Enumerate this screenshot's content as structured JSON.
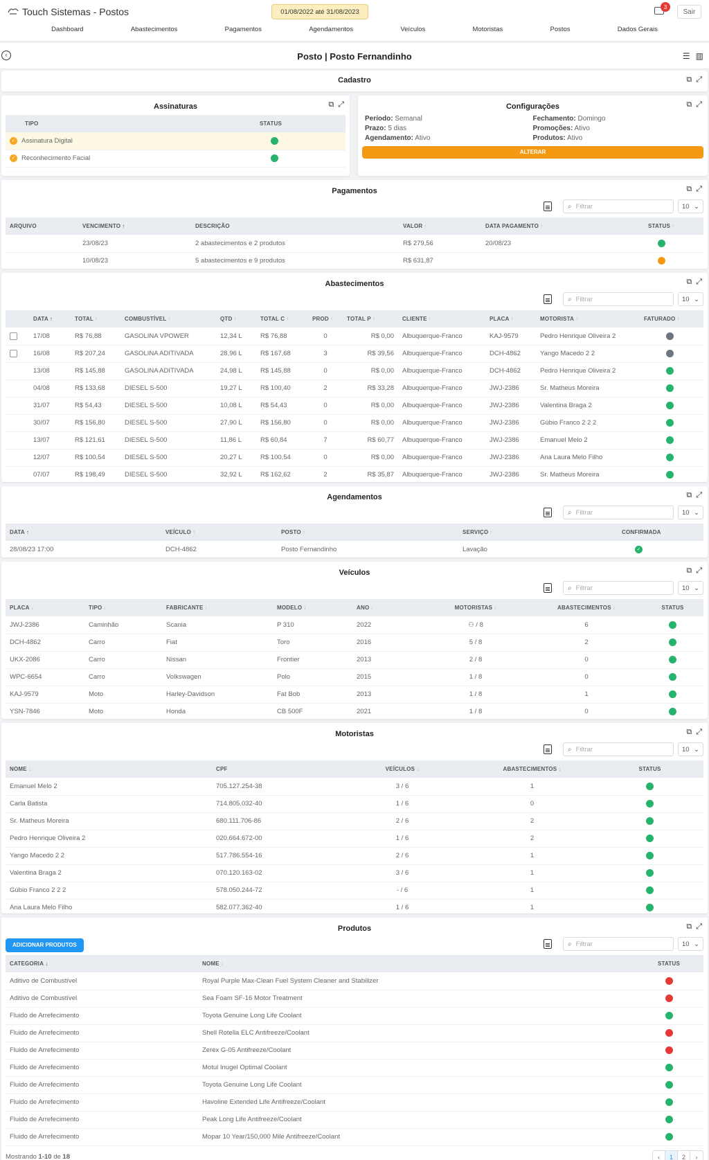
{
  "app": {
    "title": "Touch Sistemas - Postos",
    "date_range": "01/08/2022 até 31/08/2023",
    "notif_count": "3",
    "logout": "Sair"
  },
  "nav": [
    "Dashboard",
    "Abastecimentos",
    "Pagamentos",
    "Agendamentos",
    "Veículos",
    "Motoristas",
    "Postos",
    "Dados Gerais"
  ],
  "page": {
    "title": "Posto | Posto Fernandinho"
  },
  "cadastro": {
    "title": "Cadastro"
  },
  "filter_placeholder": "Filtrar",
  "page_size": "10",
  "colors": {
    "green": "#26b36b",
    "gray": "#6c757d",
    "orange": "#f39a12",
    "red": "#e53935",
    "blue": "#2196f3"
  },
  "assinaturas": {
    "title": "Assinaturas",
    "headers": [
      "TIPO",
      "STATUS"
    ],
    "rows": [
      {
        "tipo": "Assinatura Digital",
        "status": "green"
      },
      {
        "tipo": "Reconhecimento Facial",
        "status": "green"
      }
    ]
  },
  "configuracoes": {
    "title": "Configurações",
    "items": [
      {
        "label": "Período:",
        "value": "Semanal"
      },
      {
        "label": "Fechamento:",
        "value": "Domingo"
      },
      {
        "label": "Prazo:",
        "value": "5 dias"
      },
      {
        "label": "Promoções:",
        "value": "Ativo"
      },
      {
        "label": "Agendamento:",
        "value": "Ativo"
      },
      {
        "label": "Produtos:",
        "value": "Ativo"
      }
    ],
    "button": "ALTERAR"
  },
  "pagamentos": {
    "title": "Pagamentos",
    "headers": [
      "ARQUIVO",
      "VENCIMENTO",
      "DESCRIÇÃO",
      "VALOR",
      "DATA PAGAMENTO",
      "STATUS"
    ],
    "rows": [
      {
        "arquivo": "",
        "vencimento": "23/08/23",
        "descricao": "2 abastecimentos e 2 produtos",
        "valor": "R$ 279,56",
        "data_pagamento": "20/08/23",
        "status": "green"
      },
      {
        "arquivo": "",
        "vencimento": "10/08/23",
        "descricao": "5 abastecimentos e 9 produtos",
        "valor": "R$ 631,87",
        "data_pagamento": "",
        "status": "orange"
      }
    ]
  },
  "abastecimentos": {
    "title": "Abastecimentos",
    "headers": [
      "DATA",
      "TOTAL",
      "COMBUSTÍVEL",
      "QTD",
      "TOTAL C",
      "PROD",
      "TOTAL P",
      "CLIENTE",
      "PLACA",
      "MOTORISTA",
      "FATURADO"
    ],
    "rows": [
      {
        "check": true,
        "data": "17/08",
        "total": "R$ 76,88",
        "comb": "GASOLINA VPOWER",
        "qtd": "12,34 L",
        "totalc": "R$ 76,88",
        "prod": "0",
        "totalp": "R$ 0,00",
        "cliente": "Albuquerque-Franco",
        "placa": "KAJ-9579",
        "motorista": "Pedro Henrique Oliveira 2",
        "fat": "gray"
      },
      {
        "check": true,
        "data": "16/08",
        "total": "R$ 207,24",
        "comb": "GASOLINA ADITIVADA",
        "qtd": "28,96 L",
        "totalc": "R$ 167,68",
        "prod": "3",
        "totalp": "R$ 39,56",
        "cliente": "Albuquerque-Franco",
        "placa": "DCH-4862",
        "motorista": "Yango Macedo 2 2",
        "fat": "gray"
      },
      {
        "check": false,
        "data": "13/08",
        "total": "R$ 145,88",
        "comb": "GASOLINA ADITIVADA",
        "qtd": "24,98 L",
        "totalc": "R$ 145,88",
        "prod": "0",
        "totalp": "R$ 0,00",
        "cliente": "Albuquerque-Franco",
        "placa": "DCH-4862",
        "motorista": "Pedro Henrique Oliveira 2",
        "fat": "green"
      },
      {
        "check": false,
        "data": "04/08",
        "total": "R$ 133,68",
        "comb": "DIESEL S-500",
        "qtd": "19,27 L",
        "totalc": "R$ 100,40",
        "prod": "2",
        "totalp": "R$ 33,28",
        "cliente": "Albuquerque-Franco",
        "placa": "JWJ-2386",
        "motorista": "Sr. Matheus Moreira",
        "fat": "green"
      },
      {
        "check": false,
        "data": "31/07",
        "total": "R$ 54,43",
        "comb": "DIESEL S-500",
        "qtd": "10,08 L",
        "totalc": "R$ 54,43",
        "prod": "0",
        "totalp": "R$ 0,00",
        "cliente": "Albuquerque-Franco",
        "placa": "JWJ-2386",
        "motorista": "Valentina Braga 2",
        "fat": "green"
      },
      {
        "check": false,
        "data": "30/07",
        "total": "R$ 156,80",
        "comb": "DIESEL S-500",
        "qtd": "27,90 L",
        "totalc": "R$ 156,80",
        "prod": "0",
        "totalp": "R$ 0,00",
        "cliente": "Albuquerque-Franco",
        "placa": "JWJ-2386",
        "motorista": "Gúbio Franco 2 2 2",
        "fat": "green"
      },
      {
        "check": false,
        "data": "13/07",
        "total": "R$ 121,61",
        "comb": "DIESEL S-500",
        "qtd": "11,86 L",
        "totalc": "R$ 60,84",
        "prod": "7",
        "totalp": "R$ 60,77",
        "cliente": "Albuquerque-Franco",
        "placa": "JWJ-2386",
        "motorista": "Emanuel Melo 2",
        "fat": "green"
      },
      {
        "check": false,
        "data": "12/07",
        "total": "R$ 100,54",
        "comb": "DIESEL S-500",
        "qtd": "20,27 L",
        "totalc": "R$ 100,54",
        "prod": "0",
        "totalp": "R$ 0,00",
        "cliente": "Albuquerque-Franco",
        "placa": "JWJ-2386",
        "motorista": "Ana Laura Melo Filho",
        "fat": "green"
      },
      {
        "check": false,
        "data": "07/07",
        "total": "R$ 198,49",
        "comb": "DIESEL S-500",
        "qtd": "32,92 L",
        "totalc": "R$ 162,62",
        "prod": "2",
        "totalp": "R$ 35,87",
        "cliente": "Albuquerque-Franco",
        "placa": "JWJ-2386",
        "motorista": "Sr. Matheus Moreira",
        "fat": "green"
      }
    ]
  },
  "agendamentos": {
    "title": "Agendamentos",
    "headers": [
      "DATA",
      "VEÍCULO",
      "POSTO",
      "SERVIÇO",
      "CONFIRMADA"
    ],
    "rows": [
      {
        "data": "28/08/23 17:00",
        "veiculo": "DCH-4862",
        "posto": "Posto Fernandinho",
        "servico": "Lavação",
        "confirmada": "green"
      }
    ]
  },
  "veiculos": {
    "title": "Veículos",
    "headers": [
      "PLACA",
      "TIPO",
      "FABRICANTE",
      "MODELO",
      "ANO",
      "MOTORISTAS",
      "ABASTECIMENTOS",
      "STATUS"
    ],
    "rows": [
      {
        "placa": "JWJ-2386",
        "tipo": "Caminhão",
        "fab": "Scania",
        "modelo": "P 310",
        "ano": "2022",
        "mot": "/ 8",
        "mot_icon": true,
        "abast": "6",
        "status": "green"
      },
      {
        "placa": "DCH-4862",
        "tipo": "Carro",
        "fab": "Fiat",
        "modelo": "Toro",
        "ano": "2016",
        "mot": "5 / 8",
        "mot_icon": false,
        "abast": "2",
        "status": "green"
      },
      {
        "placa": "UKX-2086",
        "tipo": "Carro",
        "fab": "Nissan",
        "modelo": "Frontier",
        "ano": "2013",
        "mot": "2 / 8",
        "mot_icon": false,
        "abast": "0",
        "status": "green"
      },
      {
        "placa": "WPC-6654",
        "tipo": "Carro",
        "fab": "Volkswagen",
        "modelo": "Polo",
        "ano": "2015",
        "mot": "1 / 8",
        "mot_icon": false,
        "abast": "0",
        "status": "green"
      },
      {
        "placa": "KAJ-9579",
        "tipo": "Moto",
        "fab": "Harley-Davidson",
        "modelo": "Fat Bob",
        "ano": "2013",
        "mot": "1 / 8",
        "mot_icon": false,
        "abast": "1",
        "status": "green"
      },
      {
        "placa": "YSN-7846",
        "tipo": "Moto",
        "fab": "Honda",
        "modelo": "CB 500F",
        "ano": "2021",
        "mot": "1 / 8",
        "mot_icon": false,
        "abast": "0",
        "status": "green"
      }
    ]
  },
  "motoristas": {
    "title": "Motoristas",
    "headers": [
      "NOME",
      "CPF",
      "VEÍCULOS",
      "ABASTECIMENTOS",
      "STATUS"
    ],
    "rows": [
      {
        "nome": "Emanuel Melo 2",
        "cpf": "705.127.254-38",
        "veic": "3 / 6",
        "abast": "1",
        "status": "green"
      },
      {
        "nome": "Carla Batista",
        "cpf": "714.805.032-40",
        "veic": "1 / 6",
        "abast": "0",
        "status": "green"
      },
      {
        "nome": "Sr. Matheus Moreira",
        "cpf": "680.111.706-86",
        "veic": "2 / 6",
        "abast": "2",
        "status": "green"
      },
      {
        "nome": "Pedro Henrique Oliveira 2",
        "cpf": "020.664.672-00",
        "veic": "1 / 6",
        "abast": "2",
        "status": "green"
      },
      {
        "nome": "Yango Macedo 2 2",
        "cpf": "517.786.554-16",
        "veic": "2 / 6",
        "abast": "1",
        "status": "green"
      },
      {
        "nome": "Valentina Braga 2",
        "cpf": "070.120.163-02",
        "veic": "3 / 6",
        "abast": "1",
        "status": "green"
      },
      {
        "nome": "Gúbio Franco 2 2 2",
        "cpf": "578.050.244-72",
        "veic": "- / 6",
        "abast": "1",
        "status": "green"
      },
      {
        "nome": "Ana Laura Melo Filho",
        "cpf": "582.077.362-40",
        "veic": "1 / 6",
        "abast": "1",
        "status": "green"
      }
    ]
  },
  "produtos": {
    "title": "Produtos",
    "add_button": "ADICIONAR PRODUTOS",
    "headers": [
      "CATEGORIA",
      "NOME",
      "STATUS"
    ],
    "rows": [
      {
        "cat": "Aditivo de Combustível",
        "nome": "Royal Purple Max-Clean Fuel System Cleaner and Stabilizer",
        "status": "red"
      },
      {
        "cat": "Aditivo de Combustível",
        "nome": "Sea Foam SF-16 Motor Treatment",
        "status": "red"
      },
      {
        "cat": "Fluido de Arrefecimento",
        "nome": "Toyota Genuine Long Life Coolant",
        "status": "green"
      },
      {
        "cat": "Fluido de Arrefecimento",
        "nome": "Shell Rotella ELC Antifreeze/Coolant",
        "status": "red"
      },
      {
        "cat": "Fluido de Arrefecimento",
        "nome": "Zerex G-05 Antifreeze/Coolant",
        "status": "red"
      },
      {
        "cat": "Fluido de Arrefecimento",
        "nome": "Motul Inugel Optimal Coolant",
        "status": "green"
      },
      {
        "cat": "Fluido de Arrefecimento",
        "nome": "Toyota Genuine Long Life Coolant",
        "status": "green"
      },
      {
        "cat": "Fluido de Arrefecimento",
        "nome": "Havoline Extended Life Antifreeze/Coolant",
        "status": "green"
      },
      {
        "cat": "Fluido de Arrefecimento",
        "nome": "Peak Long Life Antifreeze/Coolant",
        "status": "green"
      },
      {
        "cat": "Fluido de Arrefecimento",
        "nome": "Mopar 10 Year/150,000 Mile Antifreeze/Coolant",
        "status": "green"
      }
    ],
    "footer_prefix": "Mostrando",
    "footer_range": "1-10",
    "footer_of": "de",
    "footer_total": "18",
    "pages": [
      "‹",
      "1",
      "2",
      "›"
    ]
  }
}
